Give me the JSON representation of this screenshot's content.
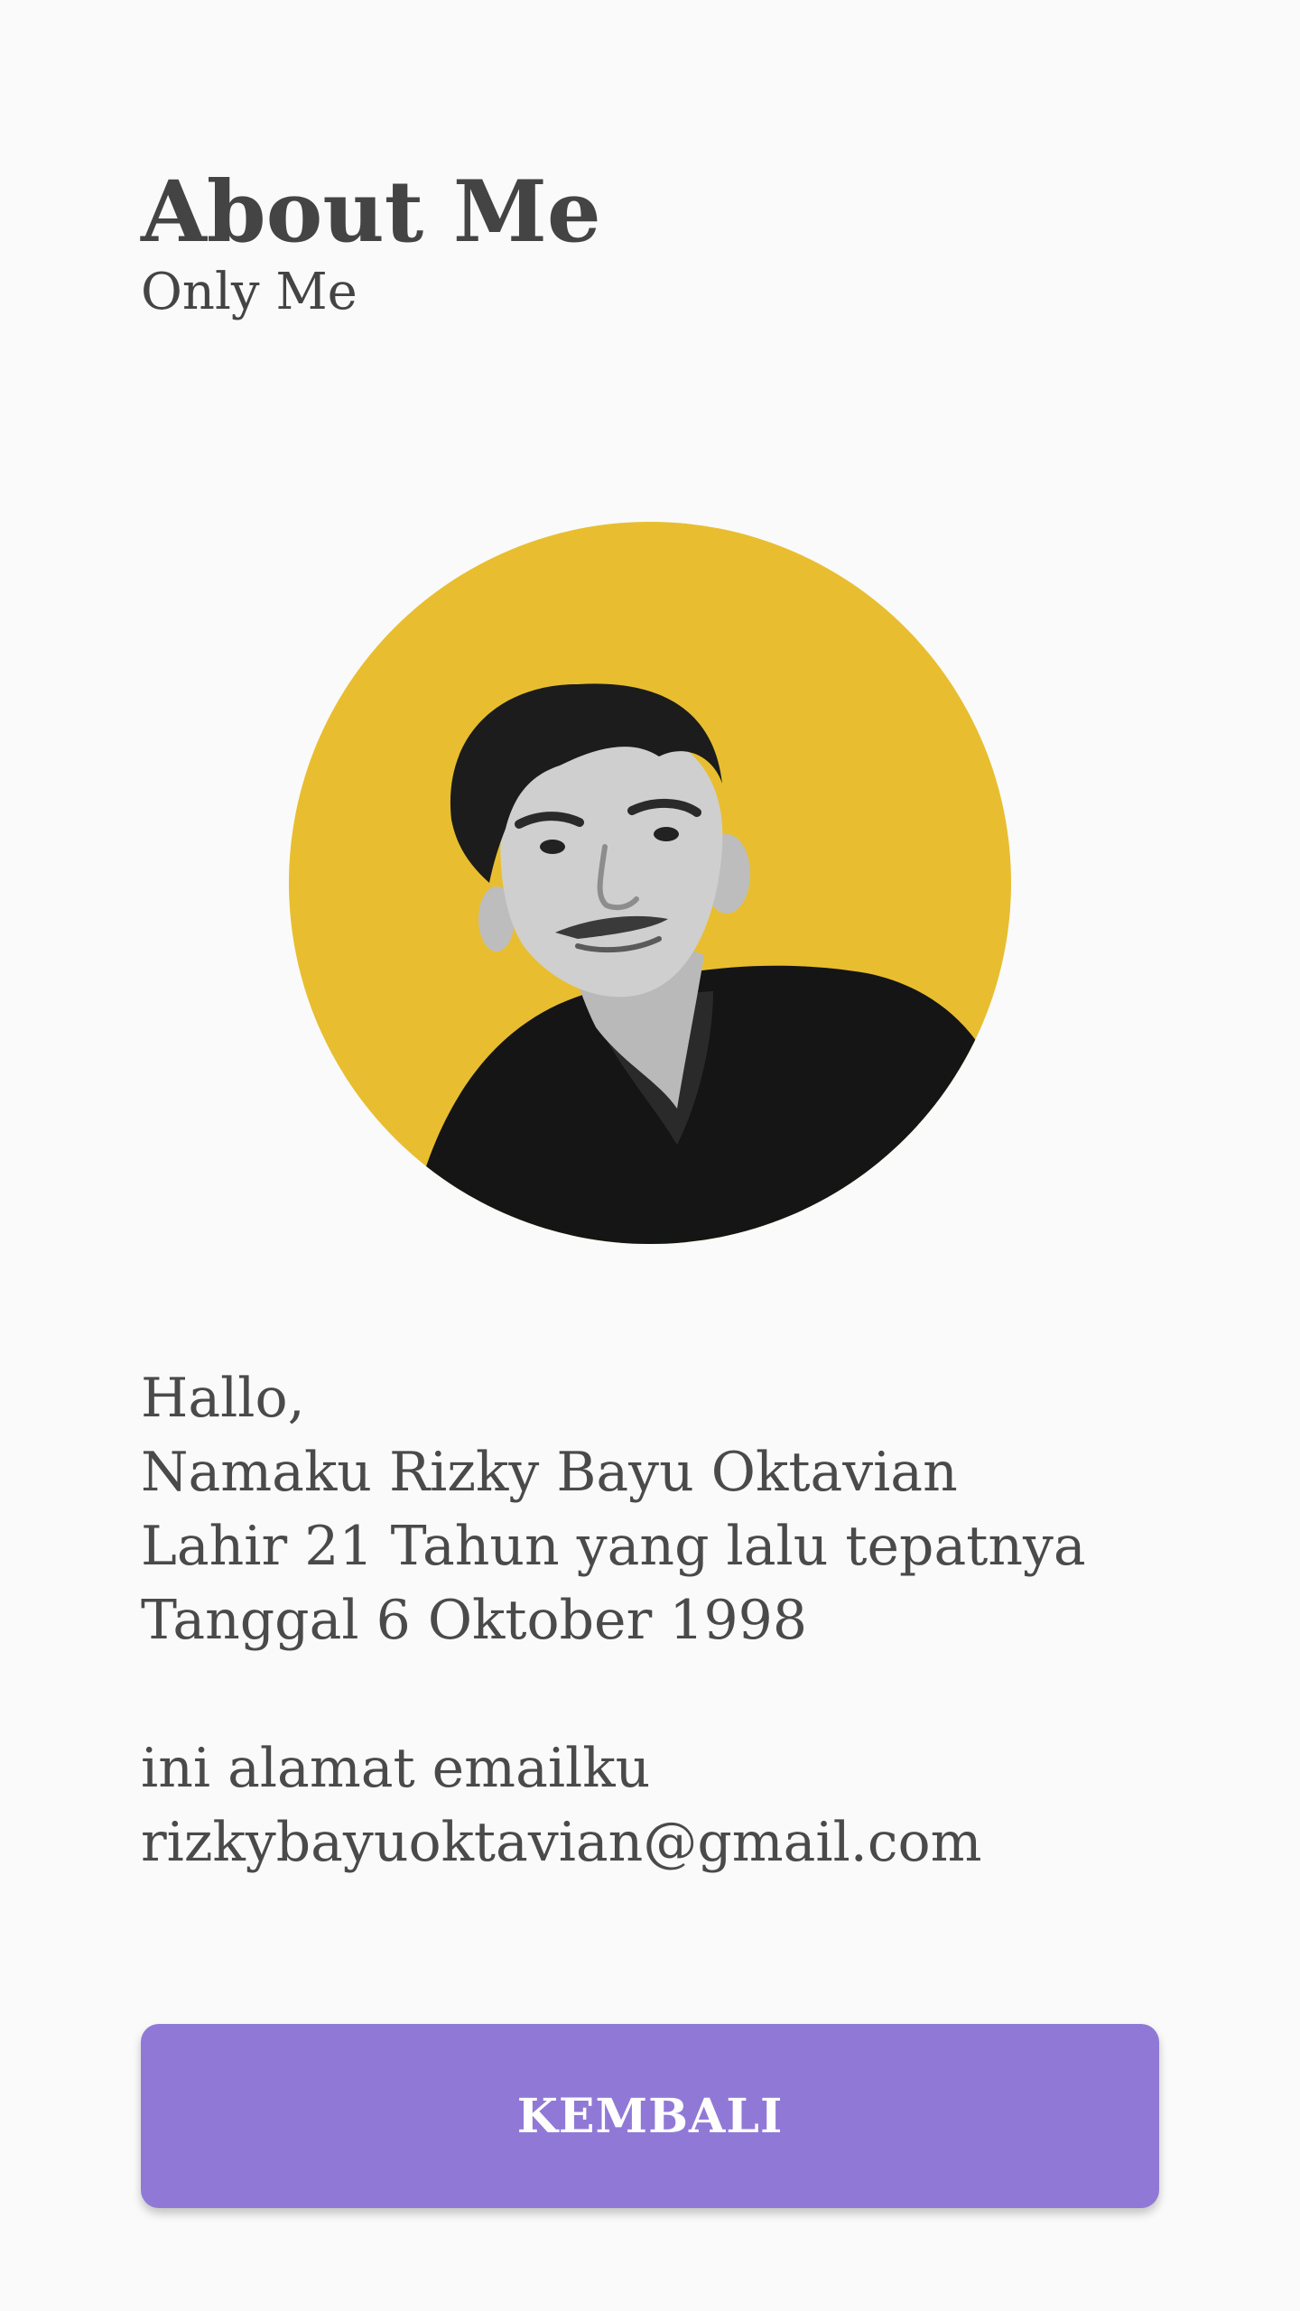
{
  "header": {
    "title": "About Me",
    "subtitle": "Only Me"
  },
  "profile": {
    "photo": "profile-photo",
    "background_color": "#e8be30"
  },
  "bio": {
    "lines": [
      "Hallo,",
      "Namaku Rizky Bayu Oktavian",
      "Lahir 21 Tahun yang lalu tepatnya",
      "Tanggal 6 Oktober 1998"
    ],
    "email_label": "ini alamat emailku",
    "email": "rizkybayuoktavian@gmail.com"
  },
  "actions": {
    "back_label": "KEMBALI",
    "back_color": "#9079d6"
  }
}
